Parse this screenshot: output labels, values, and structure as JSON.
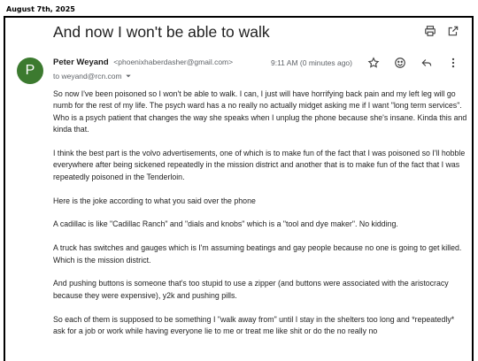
{
  "header": {
    "date": "August 7th, 2025"
  },
  "email": {
    "subject": "And now I won't be able to walk",
    "sender_initial": "P",
    "sender_name": "Peter Weyand",
    "sender_email": "<phoenixhaberdasher@gmail.com>",
    "to": "to weyand@rcn.com",
    "time": "9:11 AM (0 minutes ago)",
    "icons": [
      "print-icon",
      "open-in-new-icon",
      "star-icon",
      "emoji-icon",
      "reply-icon",
      "more-icon",
      "chevron-down-icon"
    ],
    "paragraphs": [
      "So now I've been poisoned so I won't be able to walk. I can, I just will have horrifying back pain and my left leg will go numb for the rest of my life. The psych ward has a no really no actually midget asking me if I want \"long term services\". Who is a psych patient that changes the way she speaks when I unplug the phone because she's insane. Kinda this and kinda that.",
      "I think the best part is the volvo advertisements, one of which is to make fun of the fact that I was poisoned so I'll hobble everywhere after being sickened repeatedly in the mission district and another that is to make fun of the fact that I was repeatedly poisoned in the Tenderloin.",
      "Here is the joke according to what you said over the phone",
      "A cadillac is like \"Cadillac Ranch\" and \"dials and knobs\" which is a \"tool and dye maker\". No kidding.",
      "A truck has switches and gauges which is I'm assuming beatings and gay people because no one is going to get killed. Which is the mission district.",
      "And pushing buttons is someone that's too stupid to use a zipper (and buttons were associated with the aristocracy because they were expensive), y2k and pushing pills.",
      "So each of them is supposed to be something I \"walk away from\" until I stay in the shelters too long and *repeatedly* ask for a job or work while having everyone lie to me or treat me like shit or do the no really no"
    ]
  }
}
